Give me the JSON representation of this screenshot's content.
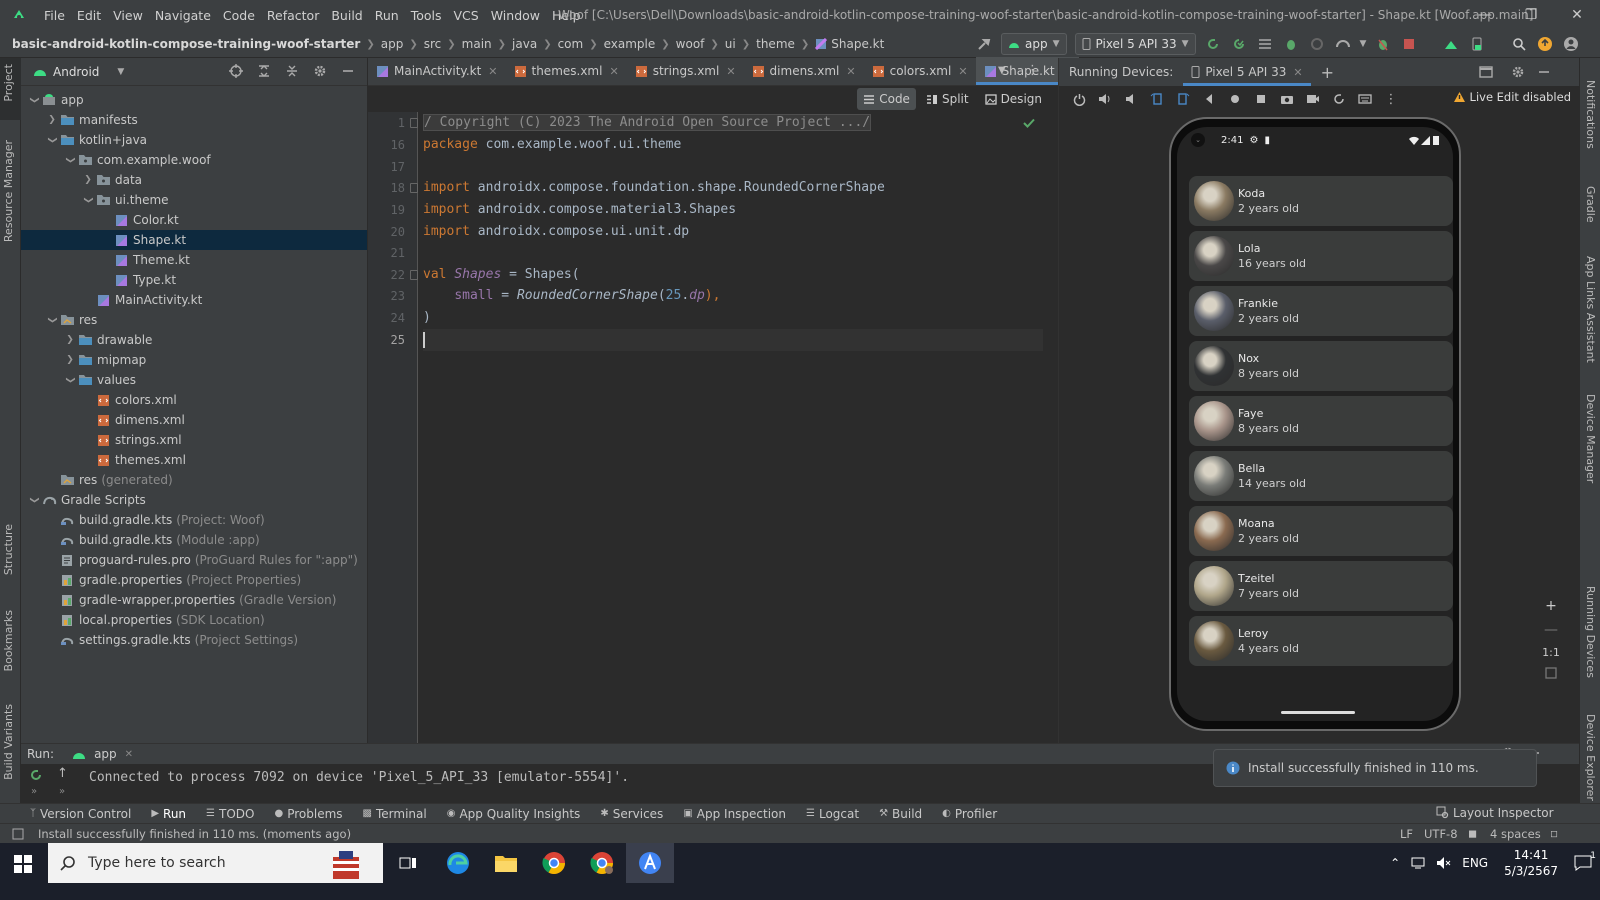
{
  "title_bar": {
    "menus": [
      "File",
      "Edit",
      "View",
      "Navigate",
      "Code",
      "Refactor",
      "Build",
      "Run",
      "Tools",
      "VCS",
      "Window",
      "Help"
    ],
    "window_title": "Woof [C:\\Users\\Dell\\Downloads\\basic-android-kotlin-compose-training-woof-starter\\basic-android-kotlin-compose-training-woof-starter] - Shape.kt [Woof.app.main]"
  },
  "breadcrumb": [
    "basic-android-kotlin-compose-training-woof-starter",
    "app",
    "src",
    "main",
    "java",
    "com",
    "example",
    "woof",
    "ui",
    "theme",
    "Shape.kt"
  ],
  "toolbar": {
    "run_config": "app",
    "device": "Pixel 5 API 33"
  },
  "left_strip": {
    "project": "Project",
    "resource_manager": "Resource Manager",
    "structure": "Structure",
    "bookmarks": "Bookmarks",
    "build_variants": "Build Variants"
  },
  "right_strip": {
    "notifications": "Notifications",
    "gradle": "Gradle",
    "app_links": "App Links Assistant",
    "device_manager": "Device Manager",
    "running_devices": "Running Devices",
    "device_explorer": "Device Explorer"
  },
  "project": {
    "view": "Android",
    "tree": [
      {
        "label": "app",
        "hint": "",
        "depth": 0,
        "arrow": "down",
        "icon": "module-icon",
        "selected": false
      },
      {
        "label": "manifests",
        "hint": "",
        "depth": 1,
        "arrow": "right",
        "icon": "folder-icon",
        "selected": false
      },
      {
        "label": "kotlin+java",
        "hint": "",
        "depth": 1,
        "arrow": "down",
        "icon": "folder-icon",
        "selected": false
      },
      {
        "label": "com.example.woof",
        "hint": "",
        "depth": 2,
        "arrow": "down",
        "icon": "package-icon",
        "selected": false
      },
      {
        "label": "data",
        "hint": "",
        "depth": 3,
        "arrow": "right",
        "icon": "package-icon",
        "selected": false
      },
      {
        "label": "ui.theme",
        "hint": "",
        "depth": 3,
        "arrow": "down",
        "icon": "package-icon",
        "selected": false
      },
      {
        "label": "Color.kt",
        "hint": "",
        "depth": 4,
        "arrow": "",
        "icon": "kotlin-file-icon",
        "selected": false
      },
      {
        "label": "Shape.kt",
        "hint": "",
        "depth": 4,
        "arrow": "",
        "icon": "kotlin-file-icon",
        "selected": true
      },
      {
        "label": "Theme.kt",
        "hint": "",
        "depth": 4,
        "arrow": "",
        "icon": "kotlin-file-icon",
        "selected": false
      },
      {
        "label": "Type.kt",
        "hint": "",
        "depth": 4,
        "arrow": "",
        "icon": "kotlin-file-icon",
        "selected": false
      },
      {
        "label": "MainActivity.kt",
        "hint": "",
        "depth": 3,
        "arrow": "",
        "icon": "kotlin-file-icon",
        "selected": false
      },
      {
        "label": "res",
        "hint": "",
        "depth": 1,
        "arrow": "down",
        "icon": "res-folder-icon",
        "selected": false
      },
      {
        "label": "drawable",
        "hint": "",
        "depth": 2,
        "arrow": "right",
        "icon": "folder-icon",
        "selected": false
      },
      {
        "label": "mipmap",
        "hint": "",
        "depth": 2,
        "arrow": "right",
        "icon": "folder-icon",
        "selected": false
      },
      {
        "label": "values",
        "hint": "",
        "depth": 2,
        "arrow": "down",
        "icon": "folder-icon",
        "selected": false
      },
      {
        "label": "colors.xml",
        "hint": "",
        "depth": 3,
        "arrow": "",
        "icon": "xml-file-icon",
        "selected": false
      },
      {
        "label": "dimens.xml",
        "hint": "",
        "depth": 3,
        "arrow": "",
        "icon": "xml-file-icon",
        "selected": false
      },
      {
        "label": "strings.xml",
        "hint": "",
        "depth": 3,
        "arrow": "",
        "icon": "xml-file-icon",
        "selected": false
      },
      {
        "label": "themes.xml",
        "hint": "",
        "depth": 3,
        "arrow": "",
        "icon": "xml-file-icon",
        "selected": false
      },
      {
        "label": "res",
        "hint": "(generated)",
        "depth": 1,
        "arrow": "",
        "icon": "res-folder-icon",
        "selected": false
      },
      {
        "label": "Gradle Scripts",
        "hint": "",
        "depth": 0,
        "arrow": "down",
        "icon": "gradle-icon",
        "selected": false
      },
      {
        "label": "build.gradle.kts",
        "hint": "(Project: Woof)",
        "depth": 1,
        "arrow": "",
        "icon": "gradle-file-icon",
        "selected": false
      },
      {
        "label": "build.gradle.kts",
        "hint": "(Module :app)",
        "depth": 1,
        "arrow": "",
        "icon": "gradle-file-icon",
        "selected": false
      },
      {
        "label": "proguard-rules.pro",
        "hint": "(ProGuard Rules for \":app\")",
        "depth": 1,
        "arrow": "",
        "icon": "text-file-icon",
        "selected": false
      },
      {
        "label": "gradle.properties",
        "hint": "(Project Properties)",
        "depth": 1,
        "arrow": "",
        "icon": "properties-file-icon",
        "selected": false
      },
      {
        "label": "gradle-wrapper.properties",
        "hint": "(Gradle Version)",
        "depth": 1,
        "arrow": "",
        "icon": "properties-file-icon",
        "selected": false
      },
      {
        "label": "local.properties",
        "hint": "(SDK Location)",
        "depth": 1,
        "arrow": "",
        "icon": "properties-file-icon",
        "selected": false
      },
      {
        "label": "settings.gradle.kts",
        "hint": "(Project Settings)",
        "depth": 1,
        "arrow": "",
        "icon": "gradle-file-icon",
        "selected": false
      }
    ]
  },
  "editor": {
    "tabs": [
      {
        "label": "MainActivity.kt",
        "icon": "kotlin-file-icon",
        "active": false
      },
      {
        "label": "themes.xml",
        "icon": "xml-file-icon",
        "active": false
      },
      {
        "label": "strings.xml",
        "icon": "xml-file-icon",
        "active": false
      },
      {
        "label": "dimens.xml",
        "icon": "xml-file-icon",
        "active": false
      },
      {
        "label": "colors.xml",
        "icon": "xml-file-icon",
        "active": false
      },
      {
        "label": "Shape.kt",
        "icon": "kotlin-file-icon",
        "active": true
      }
    ],
    "view_modes": {
      "code": "Code",
      "split": "Split",
      "design": "Design"
    },
    "lines": [
      {
        "num": "1",
        "segments": [
          {
            "t": "/ Copyright (C) 2023 The Android Open Source Project .../",
            "c": "fold"
          }
        ]
      },
      {
        "num": "16",
        "segments": [
          {
            "t": "package ",
            "c": "kw"
          },
          {
            "t": "com.example.woof.ui.theme",
            "c": ""
          }
        ]
      },
      {
        "num": "17",
        "segments": []
      },
      {
        "num": "18",
        "segments": [
          {
            "t": "import ",
            "c": "kw"
          },
          {
            "t": "androidx.compose.foundation.shape.RoundedCornerShape",
            "c": ""
          }
        ]
      },
      {
        "num": "19",
        "segments": [
          {
            "t": "import ",
            "c": "kw"
          },
          {
            "t": "androidx.compose.material3.Shapes",
            "c": ""
          }
        ]
      },
      {
        "num": "20",
        "segments": [
          {
            "t": "import ",
            "c": "kw"
          },
          {
            "t": "androidx.compose.ui.unit.dp",
            "c": ""
          }
        ]
      },
      {
        "num": "21",
        "segments": []
      },
      {
        "num": "22",
        "segments": [
          {
            "t": "val ",
            "c": "kw"
          },
          {
            "t": "Shapes",
            "c": "it"
          },
          {
            "t": " = Shapes(",
            "c": ""
          }
        ]
      },
      {
        "num": "23",
        "segments": [
          {
            "t": "    ",
            "c": ""
          },
          {
            "t": "small",
            "c": "pr"
          },
          {
            "t": " = ",
            "c": ""
          },
          {
            "t": "RoundedCornerShape",
            "c": "fn"
          },
          {
            "t": "(",
            "c": ""
          },
          {
            "t": "25",
            "c": "num"
          },
          {
            "t": ".",
            "c": ""
          },
          {
            "t": "dp",
            "c": "it"
          },
          {
            "t": "),",
            "c": "kw"
          }
        ]
      },
      {
        "num": "24",
        "segments": [
          {
            "t": ")",
            "c": ""
          }
        ]
      },
      {
        "num": "25",
        "segments": [],
        "current": true
      }
    ]
  },
  "running_devices": {
    "label": "Running Devices:",
    "device_tab": "Pixel 5 API 33",
    "live_edit": "Live Edit disabled",
    "phone": {
      "time": "2:41",
      "dogs": [
        {
          "name": "Koda",
          "age": "2 years old",
          "color": "#8a7a62"
        },
        {
          "name": "Lola",
          "age": "16 years old",
          "color": "#4a4848"
        },
        {
          "name": "Frankie",
          "age": "2 years old",
          "color": "#5a5e6a"
        },
        {
          "name": "Nox",
          "age": "8 years old",
          "color": "#303234"
        },
        {
          "name": "Faye",
          "age": "8 years old",
          "color": "#a8948a"
        },
        {
          "name": "Bella",
          "age": "14 years old",
          "color": "#7a7c78"
        },
        {
          "name": "Moana",
          "age": "2 years old",
          "color": "#8a6a50"
        },
        {
          "name": "Tzeitel",
          "age": "7 years old",
          "color": "#b0a68a"
        },
        {
          "name": "Leroy",
          "age": "4 years old",
          "color": "#6a5a40"
        }
      ]
    },
    "zoom_ratio": "1:1"
  },
  "run_panel": {
    "label": "Run:",
    "config_tab": "app",
    "console": "Connected to process 7092 on device 'Pixel_5_API_33 [emulator-5554]'."
  },
  "notification": "Install successfully finished in 110 ms.",
  "tool_windows": [
    "Version Control",
    "Run",
    "TODO",
    "Problems",
    "Terminal",
    "App Quality Insights",
    "Services",
    "App Inspection",
    "Logcat",
    "Build",
    "Profiler"
  ],
  "layout_inspector": "Layout Inspector",
  "status_bar": {
    "message": "Install successfully finished in 110 ms. (moments ago)",
    "line_sep": "LF",
    "encoding": "UTF-8",
    "indent": "4 spaces"
  },
  "taskbar": {
    "search_placeholder": "Type here to search",
    "lang": "ENG",
    "time": "14:41",
    "date": "5/3/2567",
    "notif_count": "1"
  },
  "colors": {
    "accent": "#4a88c7",
    "selection": "#0d293e",
    "android_green": "#3ddc84"
  }
}
